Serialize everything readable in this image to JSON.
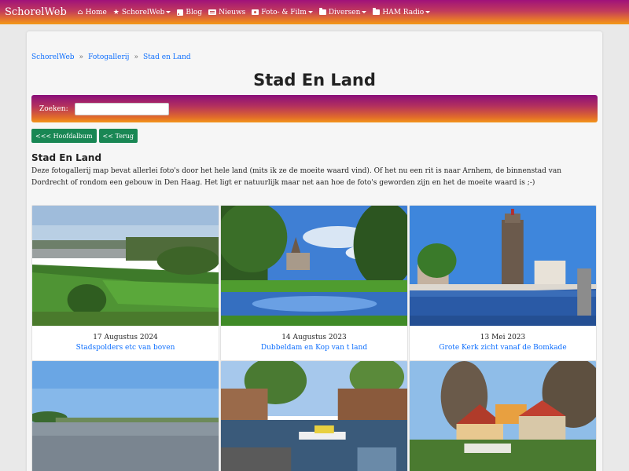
{
  "navbar": {
    "brand": "SchorelWeb",
    "items": [
      {
        "label": "Home",
        "icon": "home-icon"
      },
      {
        "label": "SchorelWeb",
        "icon": "star-icon"
      },
      {
        "label": "Blog",
        "icon": "rss-icon"
      },
      {
        "label": "Nieuws",
        "icon": "newspaper-icon"
      },
      {
        "label": "Foto- & Film",
        "icon": "camera-icon"
      },
      {
        "label": "Diversen",
        "icon": "folder-icon"
      },
      {
        "label": "HAM Radio",
        "icon": "folder-icon"
      }
    ]
  },
  "breadcrumb": [
    "SchorelWeb",
    "Fotogallerij",
    "Stad en Land"
  ],
  "page": {
    "title": "Stad En Land",
    "search_label": "Zoeken:",
    "search_value": "",
    "buttons": [
      "<<< Hoofdalbum",
      "<< Terug"
    ],
    "section_title": "Stad En Land",
    "description": "Deze fotogallerij map bevat allerlei foto's door het hele land (mits ik ze de moeite waard vind). Of het nu een rit is naar Arnhem, de binnenstad van Dordrecht of rondom een gebouw in Den Haag. Het ligt er natuurlijk maar net aan hoe de foto's geworden zijn en het de moeite waard is ;-)"
  },
  "gallery": [
    {
      "date": "17 Augustus 2024",
      "title": "Stadspolders etc van boven"
    },
    {
      "date": "14 Augustus 2023",
      "title": "Dubbeldam en Kop van t land"
    },
    {
      "date": "13 Mei 2023",
      "title": "Grote Kerk zicht vanaf de Bomkade"
    },
    {
      "date": "",
      "title": ""
    },
    {
      "date": "",
      "title": ""
    },
    {
      "date": "",
      "title": ""
    }
  ],
  "colors": {
    "accent_link": "#0d6efd",
    "button_green": "#198754",
    "gradient_top": "#a0127a",
    "gradient_bottom": "#f39a16"
  }
}
